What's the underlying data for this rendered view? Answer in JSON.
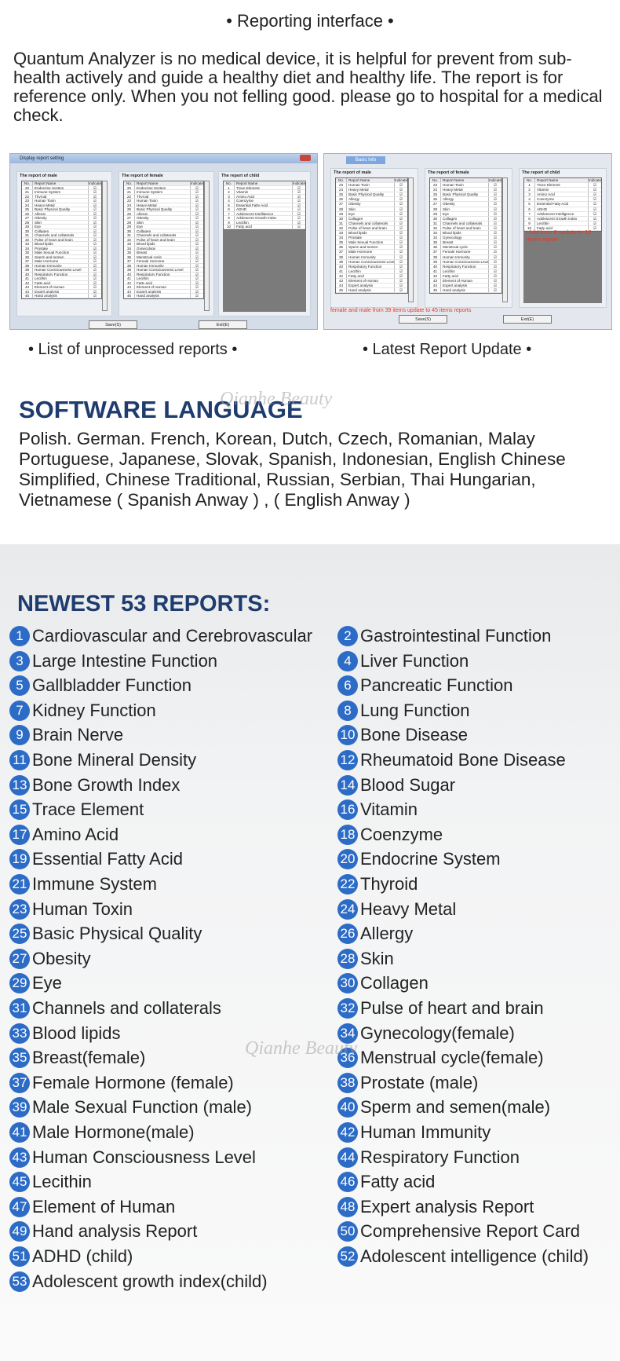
{
  "title": "• Reporting interface •",
  "intro": "Quantum Analyzer is no medical device, it is helpful for prevent from sub-health actively and guide a healthy diet and healthy life. The report is for reference only.  When you not felling good. please go to hospital for a medical check.",
  "left_shot": {
    "window_title": "Display report setting",
    "male_title": "The report of male",
    "female_title": "The report of female",
    "child_title": "The report of child",
    "headers": [
      "No.",
      "Report Name",
      "Indicate"
    ],
    "start": 20,
    "male": [
      "Endocrine System",
      "Immune System",
      "Thyroid",
      "Human Toxin",
      "Heavy Metal",
      "Basic Physical Quality",
      "Allergy",
      "Obesity",
      "Skin",
      "Eye",
      "Collagen",
      "Channels and collaterals",
      "Pulse of heart and brain",
      "Blood lipids",
      "Prostate",
      "Male Sexual Function",
      "Sperm and semen",
      "Male Hormone",
      "Human Immunity",
      "Human Consciousness Level",
      "Respiratory Function",
      "Lecithin",
      "Fatty acid",
      "Element of Human",
      "Expert analysis",
      "Hand analysis"
    ],
    "female": [
      "Endocrine System",
      "Immune System",
      "Thyroid",
      "Human Toxin",
      "Heavy Metal",
      "Basic Physical Quality",
      "Allergy",
      "Obesity",
      "Skin",
      "Eye",
      "Collagen",
      "Channels and collaterals",
      "Pulse of heart and brain",
      "Blood lipids",
      "Gynecology",
      "Breast",
      "Menstrual cycle",
      "Female Hormone",
      "Human Immunity",
      "Human Consciousness Level",
      "Respiratory Function",
      "Lecithin",
      "Fatty acid",
      "Element of Human",
      "Expert analysis",
      "Hand analysis"
    ],
    "child": [
      "Trace Element",
      "Vitamin",
      "Amino Acid",
      "Coenzyme",
      "Essential Fatty Acid",
      "ADHD",
      "Adolescent Intelligence",
      "Adolescent Growth Index",
      "Lecithin",
      "Fatty acid"
    ],
    "check": "☑",
    "save": "Save(S)",
    "exit": "Exit(E)"
  },
  "right_shot": {
    "tab": "Basic Info",
    "male_title": "The report of male",
    "female_title": "The report of female",
    "child_title": "The report of child",
    "headers": [
      "No.",
      "Report Name",
      "Indicate"
    ],
    "start": 23,
    "male": [
      "Human Toxin",
      "Heavy Metal",
      "Basic Physical Quality",
      "Allergy",
      "Obesity",
      "Skin",
      "Eye",
      "Collagen",
      "Channels and collaterals",
      "Pulse of heart and brain",
      "Blood lipids",
      "Prostate",
      "Male Sexual Function",
      "Sperm and semen",
      "Male Hormone",
      "Human Immunity",
      "Human Consciousness Level",
      "Respiratory Function",
      "Lecithin",
      "Fatty acid",
      "Element of Human",
      "Expert analysis",
      "Hand analysis"
    ],
    "female": [
      "Human Toxin",
      "Heavy Metal",
      "Basic Physical Quality",
      "Allergy",
      "Obesity",
      "Skin",
      "Eye",
      "Collagen",
      "Channels and collaterals",
      "Pulse of heart and brain",
      "Blood lipids",
      "Gynecology",
      "Breast",
      "Menstrual cycle",
      "Female Hormone",
      "Human Immunity",
      "Human Consciousness Level",
      "Respiratory Function",
      "Lecithin",
      "Fatty acid",
      "Element of Human",
      "Expert analysis",
      "Hand analysis"
    ],
    "child": [
      "Trace Element",
      "Vitamin",
      "Amino Acid",
      "Coenzyme",
      "Essential Fatty Acid",
      "ADHD",
      "Adolescent Intelligence",
      "Adolescent Growth Index",
      "Lecithin",
      "Fatty acid"
    ],
    "check": "☑",
    "note_child": "child from 6 update to 10 items report",
    "note_adult": "female and male from 39 items update to 45 items reports",
    "save": "Save(S)",
    "exit": "Exit(E)",
    "annotation_color": "#e23a2a"
  },
  "captions": {
    "left": "• List of unprocessed reports •",
    "right": "• Latest Report Update •"
  },
  "watermark": "Qianhe Beauty",
  "language": {
    "heading": "SOFTWARE LANGUAGE",
    "text": "Polish. German. French, Korean, Dutch, Czech, Romanian, Malay Portuguese, Japanese, Slovak, Spanish, Indonesian, English Chinese Simplified, Chinese Traditional, Russian, Serbian, Thai Hungarian, Vietnamese ( Spanish Anway ) , ( English Anway )"
  },
  "reports": {
    "heading": "NEWEST 53 REPORTS:",
    "badge_color": "#2d6cc6",
    "items": [
      "Cardiovascular and Cerebrovascular",
      "Gastrointestinal Function",
      "Large Intestine Function",
      "Liver Function",
      "Gallbladder Function",
      "Pancreatic Function",
      "Kidney Function",
      "Lung Function",
      "Brain Nerve",
      "Bone Disease",
      "Bone Mineral Density",
      "Rheumatoid Bone Disease",
      "Bone Growth Index",
      "Blood Sugar",
      "Trace Element",
      "Vitamin",
      "Amino Acid",
      "Coenzyme",
      "Essential Fatty Acid",
      "Endocrine System",
      "Immune System",
      "Thyroid",
      "Human Toxin",
      "Heavy Metal",
      "Basic Physical Quality",
      "Allergy",
      "Obesity",
      "Skin",
      "Eye",
      "Collagen",
      "Channels and collaterals",
      "Pulse of heart and brain",
      "Blood lipids",
      "Gynecology(female)",
      "Breast(female)",
      "Menstrual cycle(female)",
      "Female Hormone (female)",
      "Prostate (male)",
      "Male Sexual Function (male)",
      "Sperm and semen(male)",
      "Male Hormone(male)",
      "Human Immunity",
      "Human Consciousness Level",
      "Respiratory Function",
      "Lecithin",
      "Fatty acid",
      "Element of Human",
      "Expert analysis Report",
      "Hand analysis Report",
      "Comprehensive Report Card",
      "ADHD (child)",
      "Adolescent intelligence (child)",
      "Adolescent growth index(child)"
    ]
  }
}
